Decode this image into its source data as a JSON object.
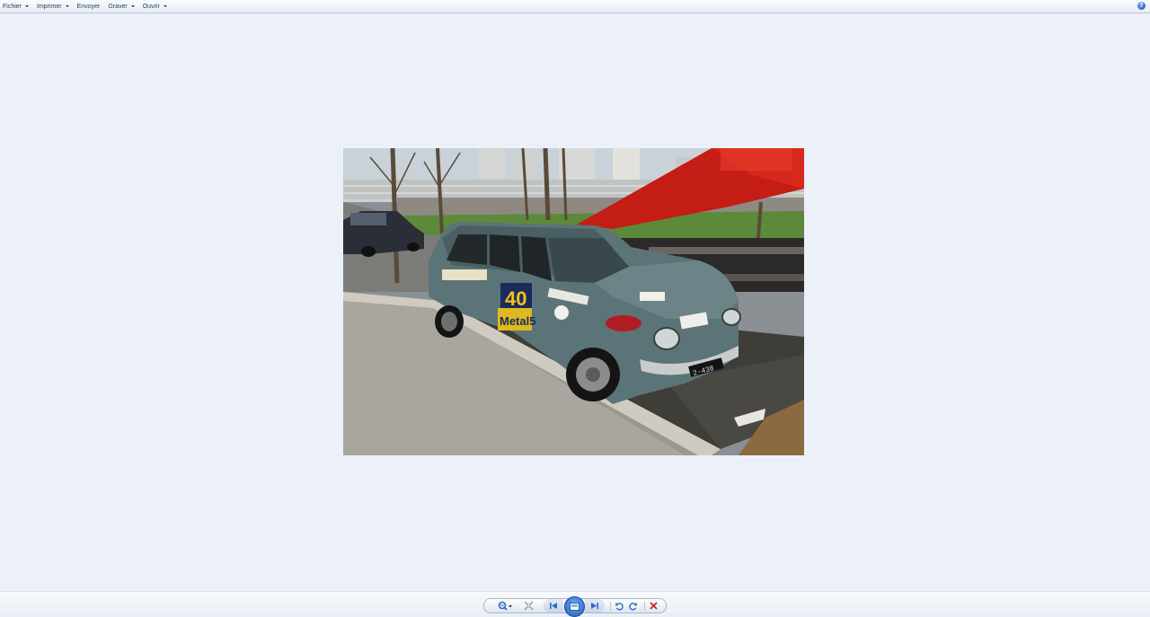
{
  "menu": {
    "items": [
      {
        "label": "Fichier",
        "has_dropdown": true
      },
      {
        "label": "Imprimer",
        "has_dropdown": true
      },
      {
        "label": "Envoyer",
        "has_dropdown": false
      },
      {
        "label": "Graver",
        "has_dropdown": true
      },
      {
        "label": "Ouvrir",
        "has_dropdown": true
      }
    ],
    "help_icon": "help-icon"
  },
  "photo": {
    "subject": "vintage blue-grey station wagon parked at curb next to red tow truck"
  },
  "toolbar": {
    "buttons": [
      {
        "icon": "zoom-icon"
      },
      {
        "icon": "actual-size-icon"
      },
      {
        "icon": "previous-icon"
      },
      {
        "icon": "slideshow-icon"
      },
      {
        "icon": "next-icon"
      },
      {
        "icon": "rotate-left-icon"
      },
      {
        "icon": "rotate-right-icon"
      },
      {
        "icon": "delete-icon"
      }
    ]
  },
  "colors": {
    "background": "#ecf1f9",
    "menu_text": "#1e395b",
    "delete_red": "#c8261e",
    "accent_blue": "#2a67c9"
  }
}
